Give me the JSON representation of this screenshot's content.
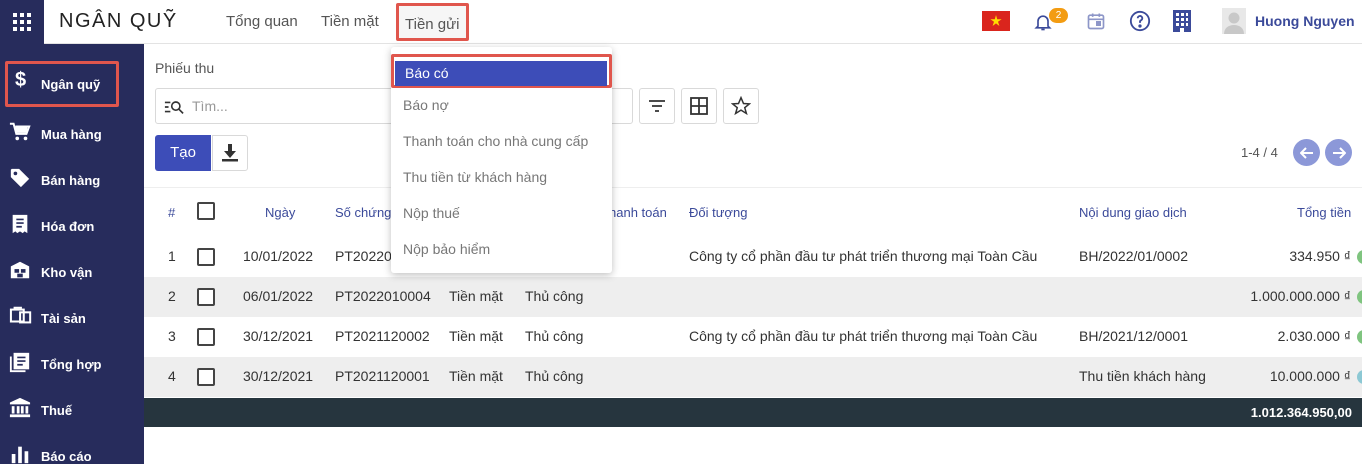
{
  "app": {
    "title": "NGÂN QUỸ"
  },
  "topnav": [
    "Tổng quan",
    "Tiền mặt",
    "Tiền gửi"
  ],
  "header": {
    "notification_count": "2",
    "username": "Huong Nguyen"
  },
  "sidebar": {
    "items": [
      {
        "label": "Ngân quỹ",
        "icon": "dollar-icon"
      },
      {
        "label": "Mua hàng",
        "icon": "cart-icon"
      },
      {
        "label": "Bán hàng",
        "icon": "tag-icon"
      },
      {
        "label": "Hóa đơn",
        "icon": "invoice-icon"
      },
      {
        "label": "Kho vận",
        "icon": "warehouse-icon"
      },
      {
        "label": "Tài sản",
        "icon": "asset-icon"
      },
      {
        "label": "Tổng hợp",
        "icon": "ledger-icon"
      },
      {
        "label": "Thuế",
        "icon": "bank-icon"
      },
      {
        "label": "Báo cáo",
        "icon": "chart-icon"
      }
    ]
  },
  "page": {
    "breadcrumb": "Phiếu thu",
    "search_placeholder": "Tìm...",
    "create_label": "Tạo",
    "pager": "1-4 / 4"
  },
  "dropdown": {
    "items": [
      "Báo có",
      "Báo nợ",
      "Thanh toán cho nhà cung cấp",
      "Thu tiền từ khách hàng",
      "Nộp thuế",
      "Nộp bảo hiểm"
    ]
  },
  "table": {
    "headers": [
      "#",
      "Ngày",
      "Số chứng",
      "hanh toán",
      "Đối tượng",
      "Nội dung giao dịch",
      "Tổng tiền"
    ],
    "rows": [
      {
        "no": "1",
        "date": "10/01/2022",
        "doc": "PT20220",
        "method": "",
        "type": "",
        "partner": "Công ty cổ phần đầu tư phát triển thương mại Toàn Cầu",
        "desc": "BH/2022/01/0002",
        "total": "334.950 ₫"
      },
      {
        "no": "2",
        "date": "06/01/2022",
        "doc": "PT2022010004",
        "method": "Tiền mặt",
        "type": "Thủ công",
        "partner": "",
        "desc": "",
        "total": "1.000.000.000 ₫"
      },
      {
        "no": "3",
        "date": "30/12/2021",
        "doc": "PT2021120002",
        "method": "Tiền mặt",
        "type": "Thủ công",
        "partner": "Công ty cổ phần đầu tư phát triển thương mại Toàn Cầu",
        "desc": "BH/2021/12/0001",
        "total": "2.030.000 ₫"
      },
      {
        "no": "4",
        "date": "30/12/2021",
        "doc": "PT2021120001",
        "method": "Tiền mặt",
        "type": "Thủ công",
        "partner": "",
        "desc": "Thu tiền khách hàng",
        "total": "10.000.000 ₫"
      }
    ],
    "grand_total": "1.012.364.950,00"
  },
  "colors": {
    "sidebar": "#272c5c",
    "primary": "#3d4db8",
    "highlight": "#e0564d",
    "footer": "#26353e"
  }
}
